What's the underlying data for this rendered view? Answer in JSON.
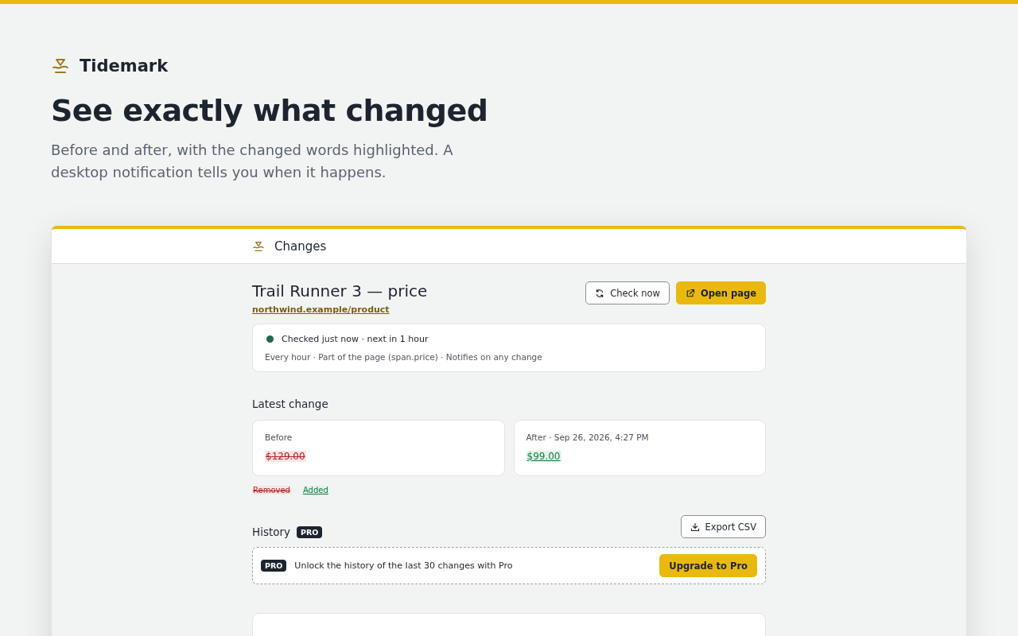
{
  "brand": {
    "name": "Tidemark"
  },
  "hero": {
    "title": "See exactly what changed",
    "text": "Before and after, with the changed words highlighted. A desktop notification tells you when it happens."
  },
  "panel": {
    "title": "Changes"
  },
  "monitor": {
    "name": "Trail Runner 3 — price",
    "url": "northwind.example/product",
    "buttons": [
      {
        "label": "Check now",
        "kind": "secondary"
      },
      {
        "label": "Open page",
        "kind": "primary"
      }
    ],
    "status": "Checked just now · next in 1 hour",
    "details": "Every hour · Part of the page (span.price) · Notifies on any change"
  },
  "latest_change": {
    "heading": "Latest change",
    "sides": [
      {
        "label": "Before",
        "value": "$129.00",
        "kind": "removed"
      },
      {
        "label": "After · Sep 26, 2026, 4:27 PM",
        "value": "$99.00",
        "kind": "added"
      }
    ],
    "legend": [
      {
        "label": "Removed",
        "kind": "removed"
      },
      {
        "label": "Added",
        "kind": "added"
      }
    ]
  },
  "history": {
    "heading": "History",
    "badge": "PRO",
    "export_button": "Export CSV",
    "upsell_badge": "PRO",
    "upsell_text": "Unlock the history of the last 30 changes with Pro",
    "upsell_button": "Upgrade to Pro"
  }
}
